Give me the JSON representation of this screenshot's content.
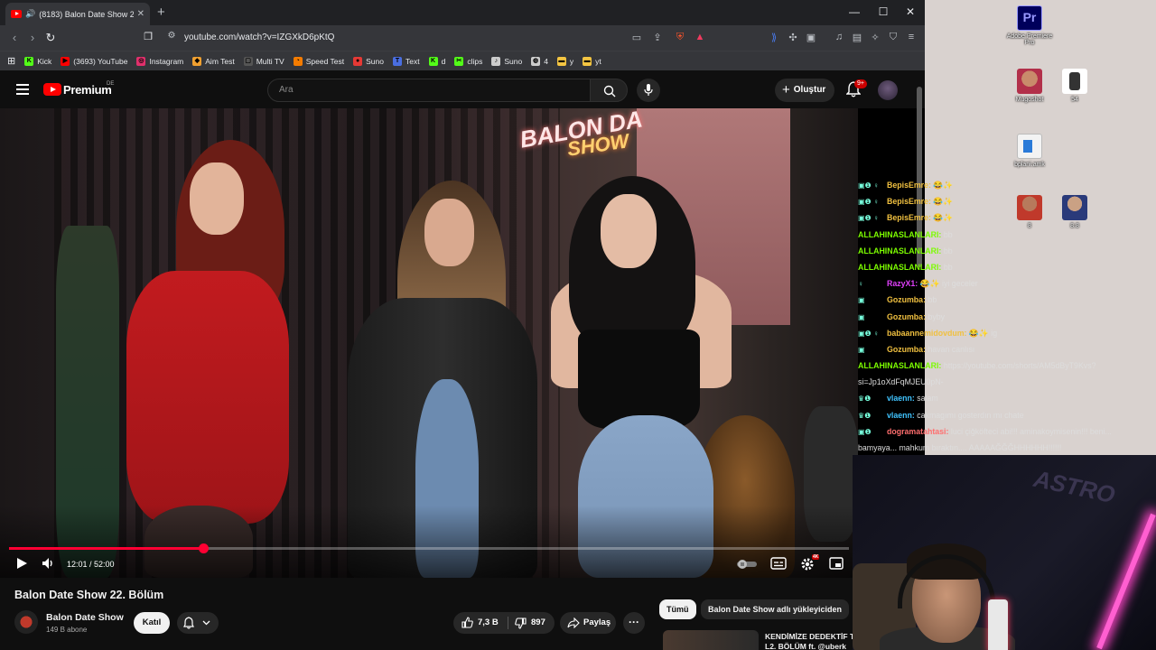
{
  "browser": {
    "tab": {
      "sound_icon": "🔊",
      "title": "(8183) Balon Date Show 22. B",
      "close": "✕"
    },
    "new_tab": "+",
    "window_controls": {
      "minimize": "—",
      "maximize": "☐",
      "close": "✕"
    },
    "url": "youtube.com/watch?v=IZGXkD6pKtQ",
    "bookmarks": [
      {
        "label": "Kick",
        "icon": "kick-icon",
        "color": "#53fc18",
        "glyph": "K"
      },
      {
        "label": "(3693) YouTube",
        "icon": "youtube-icon",
        "color": "#ff0000",
        "glyph": "▶"
      },
      {
        "label": "Instagram",
        "icon": "instagram-icon",
        "color": "#e1306c",
        "glyph": "◎"
      },
      {
        "label": "Aim Test",
        "icon": "aim-test-icon",
        "color": "#f0a030",
        "glyph": "◆"
      },
      {
        "label": "Multi TV",
        "icon": "multi-tv-icon",
        "color": "#555555",
        "glyph": "▢"
      },
      {
        "label": "Speed Test",
        "icon": "speed-test-icon",
        "color": "#f57c00",
        "glyph": "◔"
      },
      {
        "label": "Suno",
        "icon": "suno-icon",
        "color": "#e53935",
        "glyph": "●"
      },
      {
        "label": "Text",
        "icon": "text-icon",
        "color": "#4a6ee0",
        "glyph": "T"
      },
      {
        "label": "d",
        "icon": "kick-icon",
        "color": "#53fc18",
        "glyph": "K"
      },
      {
        "label": "clips",
        "icon": "clips-icon",
        "color": "#53fc18",
        "glyph": "✂"
      },
      {
        "label": "Suno",
        "icon": "suno-icon",
        "color": "#cccccc",
        "glyph": "♪"
      },
      {
        "label": "4",
        "icon": "globe-icon",
        "color": "#cccccc",
        "glyph": "◍"
      },
      {
        "label": "y",
        "icon": "folder-icon",
        "color": "#f4c542",
        "glyph": "▬"
      },
      {
        "label": "yt",
        "icon": "folder-icon",
        "color": "#f4c542",
        "glyph": "▬"
      }
    ]
  },
  "youtube": {
    "brand": "Premium",
    "region": "DE",
    "search_placeholder": "Ara",
    "create_label": "Oluştur",
    "notifications_badge": "9+",
    "video": {
      "title": "Balon Date Show 22. Bölüm",
      "current_time": "12:01",
      "duration": "52:00",
      "time_display": "12:01 / 52:00",
      "progress_fraction": 0.231,
      "overlay_sign": "BALON DA",
      "overlay_sign2": "SHOW"
    },
    "channel": {
      "name": "Balon Date Show",
      "subscribers": "149 B abone",
      "join_label": "Katıl"
    },
    "actions": {
      "likes": "7,3 B",
      "dislikes": "897",
      "share_label": "Paylaş",
      "more": "···"
    },
    "filters": [
      "Tümü",
      "Balon Date Show adlı yükleyiciden"
    ],
    "recommendation": {
      "title": "KENDİMİZE DEDEKTİF T",
      "subtitle": "L2. BÖLÜM  ft. @uberk"
    }
  },
  "desktop": {
    "icons": [
      {
        "label": "Adobe Premiere Pro",
        "icon": "premiere-pro-icon",
        "glyph": "Pr"
      },
      {
        "label": "Mugoshot",
        "icon": "mugoshot-icon"
      },
      {
        "label": "54",
        "icon": "watch-icon"
      },
      {
        "label": "bplani.amk",
        "icon": "document-icon"
      },
      {
        "label": "8",
        "icon": "image-icon"
      },
      {
        "label": "8.8",
        "icon": "image-icon"
      }
    ]
  },
  "chat": [
    {
      "badges": "▣❶ ♀",
      "user": "BepisEmre:",
      "color": "#f0c040",
      "msg": "😂✨"
    },
    {
      "badges": "▣❶ ♀",
      "user": "BepisEmre:",
      "color": "#f0c040",
      "msg": "😂✨"
    },
    {
      "badges": "▣❶ ♀",
      "user": "BepisEmre:",
      "color": "#f0c040",
      "msg": "😂✨"
    },
    {
      "badges": "",
      "user": "ALLAHINASLANLARI:",
      "color": "#7cfc00",
      "msg": "bb"
    },
    {
      "badges": "",
      "user": "ALLAHINASLANLARI:",
      "color": "#7cfc00",
      "msg": "bb"
    },
    {
      "badges": "",
      "user": "ALLAHINASLANLARI:",
      "color": "#7cfc00",
      "msg": "bb"
    },
    {
      "badges": "♀",
      "user": "RazyX1:",
      "color": "#e040fb",
      "msg": "😂✨ iyi geceler"
    },
    {
      "badges": "▣",
      "user": "Gozumba:",
      "color": "#f0c040",
      "msg": "bb"
    },
    {
      "badges": "▣",
      "user": "Gozumba:",
      "color": "#f0c040",
      "msg": "byby"
    },
    {
      "badges": "▣❶ ♀",
      "user": "babaannemidovdum:",
      "color": "#f0c040",
      "msg": "😂✨ ig"
    },
    {
      "badges": "▣",
      "user": "Gozumba:",
      "color": "#f0c040",
      "msg": "havan canlısı"
    },
    {
      "badges": "",
      "user": "ALLAHINASLANLARI:",
      "color": "#7cfc00",
      "msg": "https://youtube.com/shorts/AM5dByT9Kvs?"
    },
    {
      "badges": "",
      "user": "",
      "color": "#ffffff",
      "msg": "si=Jp1oXdFqMJEU0pN-"
    },
    {
      "badges": "♛❶",
      "user": "vlaenn:",
      "color": "#40c4ff",
      "msg": "salam"
    },
    {
      "badges": "♛❶",
      "user": "vlaenn:",
      "color": "#40c4ff",
      "msg": "cakmagımı gosterdın mı chate"
    },
    {
      "badges": "▣❶",
      "user": "dogramatahtasi:",
      "color": "#ff6e6e",
      "msg": "luci çiğköfteci abi!!! aminakoymisenin!!! beni..."
    },
    {
      "badges": "",
      "user": "",
      "color": "#ffffff",
      "msg": "bamyaya... mahkum bıraktın.... AAAAAĞĞĞHHHHHH!!!!!!"
    }
  ],
  "webcam": {
    "backdrop_text": "ASTRO"
  }
}
